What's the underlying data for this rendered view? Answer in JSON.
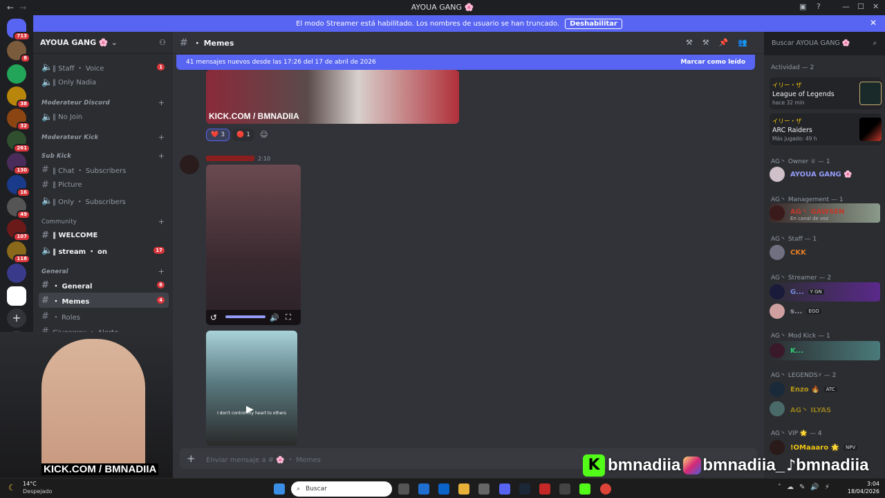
{
  "window": {
    "title": "AYOUA GANG 🌸"
  },
  "banner": {
    "text": "El modo Streamer está habilitado. Los nombres de usuario se han truncado.",
    "button": "Deshabilitar"
  },
  "rail": {
    "badges": [
      "713",
      "8",
      "38",
      "32",
      "261",
      "130",
      "16",
      "49",
      "107",
      "118"
    ]
  },
  "server": {
    "name": "AYOUA GANG 🌸"
  },
  "channels": [
    {
      "name": "‖ Staff ・ Voice",
      "count": "1"
    },
    {
      "name": "‖ Only Nadia",
      "count": ""
    },
    {
      "category": "Moderateur Discord"
    },
    {
      "name": "‖ No Join",
      "count": ""
    },
    {
      "category": "Moderateur Kick"
    },
    {
      "category": "Sub Kick"
    },
    {
      "name": "‖ Chat ・ Subscribers",
      "count": ""
    },
    {
      "name": "‖ Picture",
      "count": ""
    },
    {
      "name": "‖ Only ・ Subscribers",
      "count": ""
    },
    {
      "category": "Community"
    },
    {
      "name": "‖ WELCOME",
      "count": ""
    },
    {
      "name": "‖ stream ・ on",
      "count": "17"
    },
    {
      "category": "General"
    },
    {
      "name": "・ General",
      "count": "6"
    },
    {
      "name": "・ Memes",
      "count": "4"
    },
    {
      "name": "・ Roles",
      "count": ""
    },
    {
      "name": "Giveaway ・ Alerte",
      "count": ""
    }
  ],
  "channel_header": {
    "name": "・ Memes"
  },
  "new_messages": {
    "text": "41 mensajes nuevos desde las 17:26 del 17 de abril de 2026",
    "mark_read": "Marcar como leído"
  },
  "reactions": [
    {
      "emoji": "❤️",
      "count": "3"
    },
    {
      "emoji": "🔴",
      "count": "1"
    }
  ],
  "message": {
    "time": "2:10"
  },
  "overlay_text": {
    "kick_url": "KICK.COM / BMNADIIA",
    "video_caption": "I don't control my heart to others"
  },
  "composer": {
    "placeholder": "Enviar mensaje a # 🌸 ・ Memes"
  },
  "search": {
    "placeholder": "Buscar AYOUA GANG 🌸"
  },
  "members": {
    "activity_header": "Actividad — 2",
    "activities": [
      {
        "user": "イリー・ザ",
        "game": "League of Legends",
        "detail": "hace 32 min",
        "icon": "League of Legends"
      },
      {
        "user": "イリー・ザ",
        "game": "ARC Raiders",
        "detail": "Más jugado: 49 h",
        "icon": "ARC Raiders"
      }
    ],
    "groups": [
      {
        "header": "AG丶 Owner ♕ — 1",
        "members": [
          {
            "name": "AYOUA GANG 🌸",
            "color": "#949cf7",
            "sub": ""
          }
        ]
      },
      {
        "header": "AG丶 Management — 1",
        "members": [
          {
            "name": "AG丶 GAWSEN",
            "color": "#c0392b",
            "sub": "En canal de voz"
          }
        ]
      },
      {
        "header": "AG丶 Staff — 1",
        "members": [
          {
            "name": "CKK",
            "color": "#e67e22",
            "sub": ""
          }
        ]
      },
      {
        "header": "AG丶 Streamer — 2",
        "members": [
          {
            "name": "G...",
            "color": "#7289da",
            "sub": "",
            "tag": "Y GN"
          },
          {
            "name": "s...",
            "color": "#949ba4",
            "sub": "",
            "tag": "EGO"
          }
        ]
      },
      {
        "header": "AG丶 Mod Kick — 1",
        "members": [
          {
            "name": "K...",
            "color": "#2ecc71",
            "sub": ""
          }
        ]
      },
      {
        "header": "AG丶 LEGENDS⚡ — 2",
        "members": [
          {
            "name": "Enzo 🔥",
            "color": "#f1c40f",
            "sub": "",
            "tag": "ATC"
          },
          {
            "name": "AG丶 ILYAS",
            "color": "#f1c40f",
            "sub": ""
          }
        ]
      },
      {
        "header": "AG丶 VIP 🌟 — 4",
        "members": [
          {
            "name": "!OMaaaro 🌟",
            "color": "#f1c40f",
            "sub": "",
            "tag": "NPV"
          }
        ]
      }
    ]
  },
  "stream_overlay": {
    "handle1": "bmnadiia",
    "handle2": "bmnadiia_",
    "handle3": "bmnadiia",
    "kick": "KICK.COM / BMNADIIA"
  },
  "taskbar": {
    "weather_temp": "14°C",
    "weather_desc": "Despejado",
    "search": "Buscar",
    "time": "3:04",
    "date": "18/04/2026"
  }
}
